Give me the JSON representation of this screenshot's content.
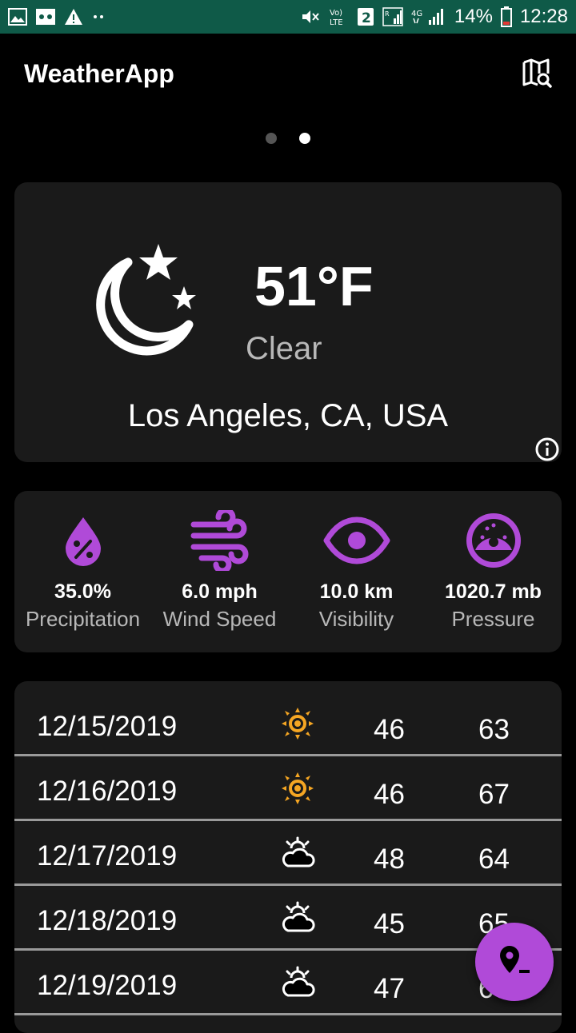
{
  "status_bar": {
    "battery": "14%",
    "time": "12:28",
    "sim_indicator": "2",
    "volte": "Vo) LTE",
    "network": "4G"
  },
  "app_bar": {
    "title": "WeatherApp",
    "map_search_icon": "map-search-icon"
  },
  "pager": {
    "count": 2,
    "active": 1
  },
  "current": {
    "temperature": "51°F",
    "condition": "Clear",
    "location": "Los Angeles, CA, USA",
    "icon": "moon-stars-icon"
  },
  "stats": [
    {
      "value": "35.0%",
      "label": "Precipitation",
      "icon": "precipitation-drop-icon"
    },
    {
      "value": "6.0 mph",
      "label": "Wind Speed",
      "icon": "wind-icon"
    },
    {
      "value": "10.0 km",
      "label": "Visibility",
      "icon": "eye-icon"
    },
    {
      "value": "1020.7 mb",
      "label": "Pressure",
      "icon": "gauge-icon"
    }
  ],
  "forecast": [
    {
      "date": "12/15/2019",
      "low": "46",
      "high": "63",
      "icon": "sunny-icon"
    },
    {
      "date": "12/16/2019",
      "low": "46",
      "high": "67",
      "icon": "sunny-icon"
    },
    {
      "date": "12/17/2019",
      "low": "48",
      "high": "64",
      "icon": "partly-cloudy-icon"
    },
    {
      "date": "12/18/2019",
      "low": "45",
      "high": "65",
      "icon": "partly-cloudy-icon"
    },
    {
      "date": "12/19/2019",
      "low": "47",
      "high": "65",
      "icon": "partly-cloudy-icon"
    }
  ],
  "colors": {
    "status_bar": "#0f5a48",
    "card": "#1a1a1a",
    "accent_purple": "#b04ad8",
    "sun_orange": "#f5a623",
    "secondary_text": "#b8b8b8"
  }
}
